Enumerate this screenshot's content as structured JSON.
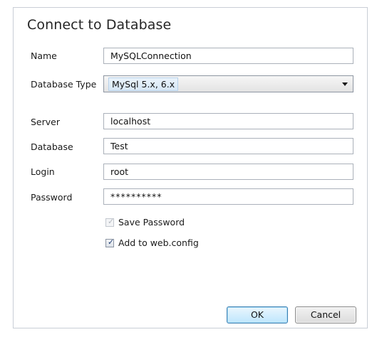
{
  "dialog": {
    "title": "Connect to Database"
  },
  "form": {
    "name_label": "Name",
    "name_value": "MySQLConnection",
    "db_type_label": "Database Type",
    "db_type_value": "MySql 5.x, 6.x",
    "server_label": "Server",
    "server_value": "localhost",
    "database_label": "Database",
    "database_value": "Test",
    "login_label": "Login",
    "login_value": "root",
    "password_label": "Password",
    "password_value": "**********"
  },
  "options": {
    "save_password_label": "Save Password",
    "save_password_checked": true,
    "save_password_enabled": false,
    "add_webconfig_label": "Add to web.config",
    "add_webconfig_checked": true
  },
  "buttons": {
    "ok_label": "OK",
    "cancel_label": "Cancel"
  },
  "icons": {
    "dropdown": "chevron-down-icon",
    "check": "checkmark-icon"
  }
}
